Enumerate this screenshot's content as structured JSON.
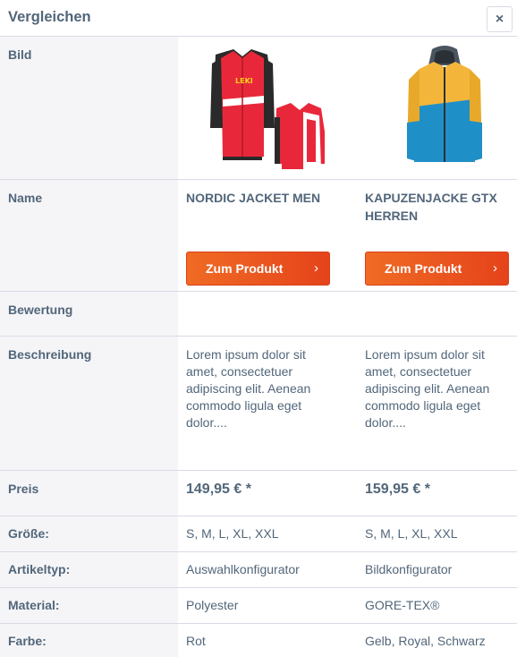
{
  "header": {
    "title": "Vergleichen",
    "close_label": "×"
  },
  "labels": {
    "bild": "Bild",
    "name": "Name",
    "bewertung": "Bewertung",
    "beschreibung": "Beschreibung",
    "preis": "Preis",
    "groesse": "Größe:",
    "artikeltyp": "Artikeltyp:",
    "material": "Material:",
    "farbe": "Farbe:"
  },
  "products": [
    {
      "name": "NORDIC JACKET MEN",
      "button_label": "Zum Produkt",
      "description": "Lorem ipsum dolor sit amet, consectetuer adipiscing elit. Aenean commodo ligula eget dolor....",
      "price": "149,95 € *",
      "groesse": "S, M, L, XL, XXL",
      "artikeltyp": "Auswahlkonfigurator",
      "material": "Polyester",
      "farbe": "Rot",
      "image_logo": "LEKI"
    },
    {
      "name": "KAPUZENJACKE GTX HERREN",
      "button_label": "Zum Produkt",
      "description": "Lorem ipsum dolor sit amet, consectetuer adipiscing elit. Aenean commodo ligula eget dolor....",
      "price": "159,95 € *",
      "groesse": "S, M, L, XL, XXL",
      "artikeltyp": "Bildkonfigurator",
      "material": "GORE-TEX®",
      "farbe": "Gelb, Royal, Schwarz"
    }
  ],
  "colors": {
    "accent": "#e8501e",
    "text": "#52667a",
    "label_bg": "#f5f5f8",
    "border": "#dadae5"
  }
}
